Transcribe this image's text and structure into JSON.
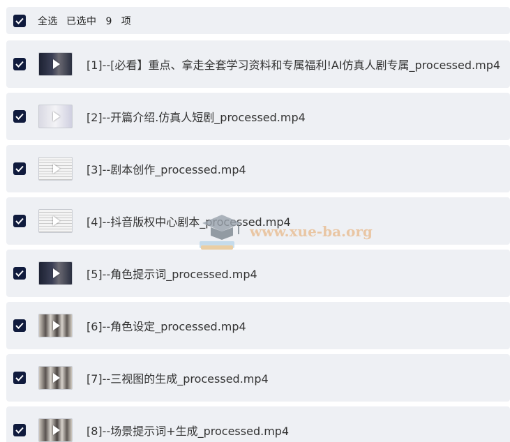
{
  "header": {
    "select_all_label": "全选",
    "selected_text": "已选中 9 项",
    "checked": true
  },
  "files": [
    {
      "name": "[1]--[必看】重点、拿走全套学习资料和专属福利!AI仿真人剧专属_processed.mp4",
      "checked": true,
      "thumb": "dark"
    },
    {
      "name": "[2]--开篇介绍.仿真人短剧_processed.mp4",
      "checked": true,
      "thumb": "light"
    },
    {
      "name": "[3]--剧本创作_processed.mp4",
      "checked": true,
      "thumb": "doc"
    },
    {
      "name": "[4]--抖音版权中心剧本_processed.mp4",
      "checked": true,
      "thumb": "doc"
    },
    {
      "name": "[5]--角色提示词_processed.mp4",
      "checked": true,
      "thumb": "dark"
    },
    {
      "name": "[6]--角色设定_processed.mp4",
      "checked": true,
      "thumb": "figures"
    },
    {
      "name": "[7]--三视图的生成_processed.mp4",
      "checked": true,
      "thumb": "figures"
    },
    {
      "name": "[8]--场景提示词+生成_processed.mp4",
      "checked": true,
      "thumb": "figures"
    }
  ],
  "watermark": {
    "text": "www.xue-ba.org"
  },
  "colors": {
    "row_bg": "#eef0f4",
    "checkbox": "#101b3d",
    "text": "#333333",
    "watermark": "#e8b98a"
  }
}
